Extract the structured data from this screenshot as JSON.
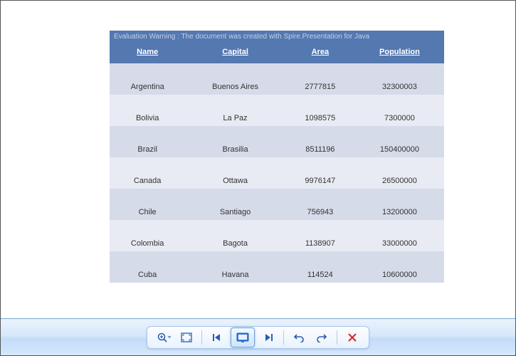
{
  "warning_text": "Evaluation Warning : The document was created with  Spire.Presentation for Java",
  "table": {
    "columns": [
      "Name",
      "Capital",
      "Area",
      "Population"
    ],
    "rows": [
      {
        "name": "Argentina",
        "capital": "Buenos Aires",
        "area": "2777815",
        "population": "32300003"
      },
      {
        "name": "Bolivia",
        "capital": "La Paz",
        "area": "1098575",
        "population": "7300000"
      },
      {
        "name": "Brazil",
        "capital": "Brasilia",
        "area": "8511196",
        "population": "150400000"
      },
      {
        "name": "Canada",
        "capital": "Ottawa",
        "area": "9976147",
        "population": "26500000"
      },
      {
        "name": "Chile",
        "capital": "Santiago",
        "area": "756943",
        "population": "13200000"
      },
      {
        "name": "Colombia",
        "capital": "Bagota",
        "area": "1138907",
        "population": "33000000"
      },
      {
        "name": "Cuba",
        "capital": "Havana",
        "area": "114524",
        "population": "10600000"
      }
    ]
  },
  "toolbar": {
    "zoom": "zoom-icon",
    "fit": "fit-screen-icon",
    "first": "first-icon",
    "slideshow": "slideshow-icon",
    "last": "last-icon",
    "undo": "undo-icon",
    "redo": "redo-icon",
    "close": "close-icon"
  },
  "colors": {
    "header_bg": "#5478b0",
    "band_a": "#d6dbe9",
    "band_b": "#e8ebf3",
    "toolbar_border": "#a9c6ea"
  }
}
